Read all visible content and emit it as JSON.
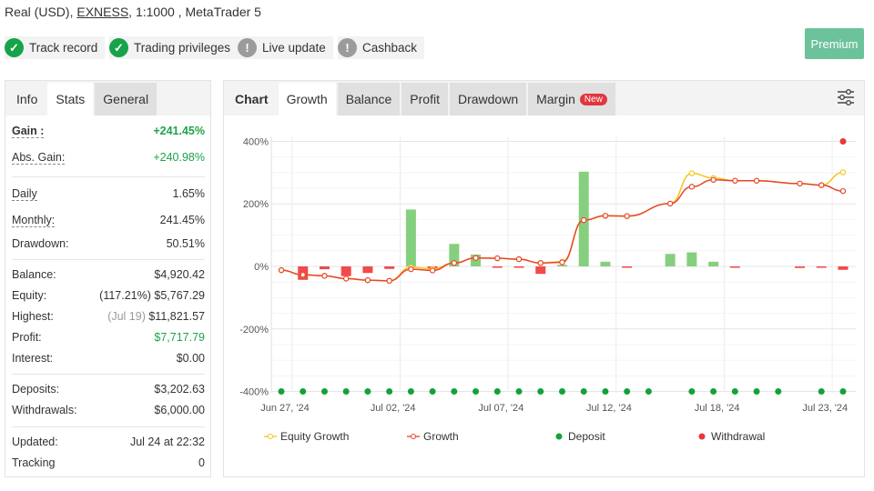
{
  "account": {
    "prefix": "Real (USD), ",
    "broker": "EXNESS",
    "suffix": ", 1:1000 , MetaTrader 5"
  },
  "badges": [
    {
      "label": "Track record",
      "status": "ok"
    },
    {
      "label": "Trading privileges",
      "status": "ok"
    },
    {
      "label": "Live update",
      "status": "warning"
    },
    {
      "label": "Cashback",
      "status": "warning"
    }
  ],
  "premium_label": "Premium",
  "left_tabs": [
    "Info",
    "Stats",
    "General"
  ],
  "stats": {
    "gain": {
      "label": "Gain :",
      "value": "+241.45%"
    },
    "abs_gain": {
      "label": "Abs. Gain:",
      "value": "+240.98%"
    },
    "daily": {
      "label": "Daily",
      "value": "1.65%"
    },
    "monthly": {
      "label": "Monthly:",
      "value": "241.45%"
    },
    "drawdown": {
      "label": "Drawdown:",
      "value": "50.51%"
    },
    "balance": {
      "label": "Balance:",
      "value": "$4,920.42"
    },
    "equity": {
      "label": "Equity:",
      "note": "(117.21%)",
      "value": "$5,767.29"
    },
    "highest": {
      "label": "Highest:",
      "note": "(Jul 19)",
      "value": "$11,821.57"
    },
    "profit": {
      "label": "Profit:",
      "value": "$7,717.79"
    },
    "interest": {
      "label": "Interest:",
      "value": "$0.00"
    },
    "deposits": {
      "label": "Deposits:",
      "value": "$3,202.63"
    },
    "withdrawals": {
      "label": "Withdrawals:",
      "value": "$6,000.00"
    },
    "updated": {
      "label": "Updated:",
      "value": "Jul 24 at 22:32"
    },
    "tracking": {
      "label": "Tracking",
      "value": "0"
    }
  },
  "chart_tabs": {
    "title": "Chart",
    "tabs": [
      "Growth",
      "Balance",
      "Profit",
      "Drawdown",
      "Margin"
    ],
    "new_badge": "New",
    "active": "Growth"
  },
  "colors": {
    "equity": "#f5c518",
    "growth": "#e8452c",
    "deposit": "#12a335",
    "withdrawal": "#e8383d",
    "bar_pos": "#86cf7e",
    "bar_neg": "#f04a4a",
    "premium": "#6cc29b"
  },
  "chart_data": {
    "type": "line",
    "ylim": [
      -400,
      400
    ],
    "yticks": [
      "400%",
      "200%",
      "0%",
      "-200%",
      "-400%"
    ],
    "xtick_labels": {
      "0": "Jun 27, '24",
      "5": "Jul 02, '24",
      "10": "Jul 07, '24",
      "15": "Jul 12, '24",
      "20": "Jul 18, '24",
      "25": "Jul 23, '24"
    },
    "grid": true,
    "legend_position": "bottom",
    "legend": [
      "Equity Growth",
      "Growth",
      "Deposit",
      "Withdrawal"
    ],
    "series": [
      {
        "name": "Equity Growth",
        "values": [
          -12,
          -27,
          -30,
          -39,
          -44,
          -46,
          -3,
          -8,
          11,
          27,
          26,
          23,
          11,
          15,
          148,
          162,
          161,
          null,
          201,
          298,
          283,
          274,
          274,
          null,
          265,
          260,
          301
        ]
      },
      {
        "name": "Growth",
        "values": [
          -12,
          -27,
          -30,
          -39,
          -44,
          -46,
          -9,
          -13,
          11,
          27,
          26,
          23,
          11,
          13,
          148,
          162,
          161,
          null,
          201,
          255,
          277,
          274,
          274,
          null,
          265,
          260,
          241
        ]
      }
    ],
    "bars": [
      0,
      -43,
      -9,
      -31,
      -21,
      -8,
      182,
      -9,
      72,
      38,
      -3,
      -3,
      -24,
      5,
      303,
      15,
      -2,
      0,
      40,
      45,
      15,
      -2,
      0,
      0,
      -5,
      -2,
      -11
    ],
    "deposit_markers": [
      0,
      1,
      2,
      3,
      4,
      5,
      6,
      7,
      8,
      9,
      10,
      11,
      12,
      13,
      14,
      15,
      16,
      17,
      19,
      20,
      21,
      22,
      23,
      25,
      26
    ],
    "withdrawal_markers": [
      26
    ]
  }
}
